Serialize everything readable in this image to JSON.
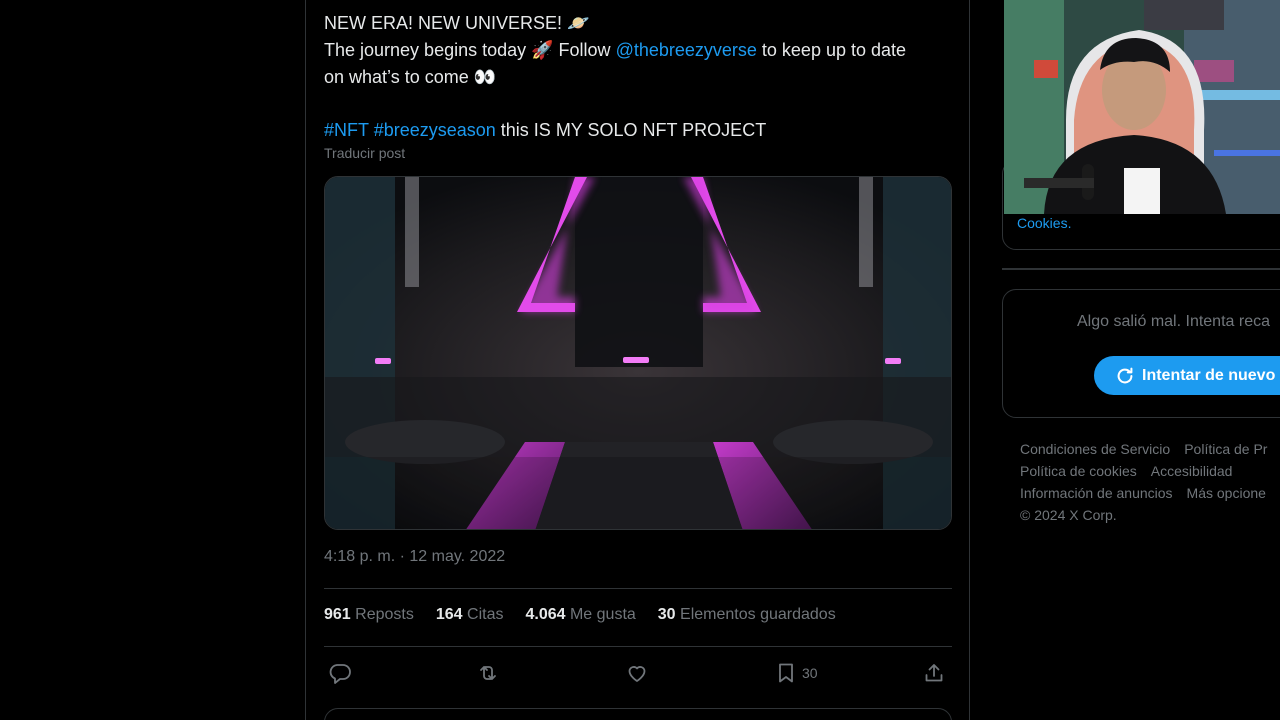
{
  "tweet": {
    "line1": "NEW ERA! NEW UNIVERSE! 🪐",
    "line2_before": "The journey begins today 🚀 Follow ",
    "line2_mention": "@thebreezyverse",
    "line2_after": " to keep up to date",
    "line3": "on what’s to come 👀",
    "hashtag1": "#NFT",
    "hashtag2": "#breezyseason",
    "line5_after": "  this IS MY SOLO NFT PROJECT",
    "translate": "Traducir post",
    "timestamp": "4:18 p. m. · 12 may. 2022"
  },
  "stats": [
    {
      "count": "961",
      "label": "Reposts"
    },
    {
      "count": "164",
      "label": "Citas"
    },
    {
      "count": "4.064",
      "label": "Me gusta"
    },
    {
      "count": "30",
      "label": "Elementos guardados"
    }
  ],
  "actions": {
    "reply_icon": "reply-icon",
    "repost_icon": "repost-icon",
    "like_icon": "heart-icon",
    "bookmark_icon": "bookmark-icon",
    "bookmark_count": "30",
    "share_icon": "share-icon"
  },
  "sidebar": {
    "cookies_link": "Cookies.",
    "error_message": "Algo salió mal. Intenta reca",
    "retry_label": "Intentar de nuevo",
    "footer_row1": [
      "Condiciones de Servicio",
      "Política de Pr"
    ],
    "footer_row2": [
      "Política de cookies",
      "Accesibilidad"
    ],
    "footer_row3": [
      "Información de anuncios",
      "Más opcione"
    ],
    "copyright": "© 2024 X Corp."
  },
  "colors": {
    "background": "#000000",
    "text": "#e7e9ea",
    "muted": "#71767b",
    "accent": "#1d9bf0",
    "border": "#2f3336",
    "neon": "#d63fe0"
  }
}
